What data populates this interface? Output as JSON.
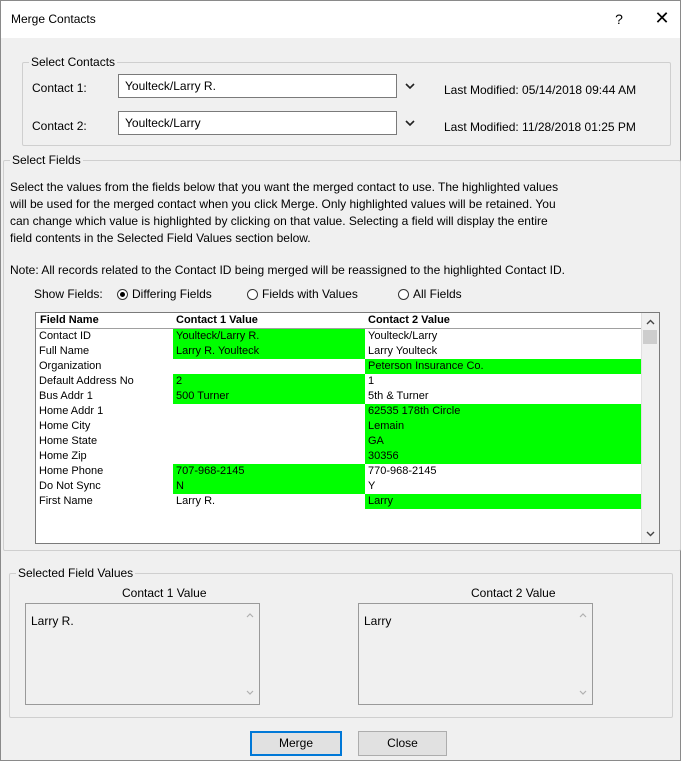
{
  "window": {
    "title": "Merge Contacts",
    "help_label": "?",
    "close_label": "✕"
  },
  "select_contacts": {
    "legend": "Select Contacts",
    "contact1_label": "Contact 1:",
    "contact1_value": "Youlteck/Larry R.",
    "contact1_modified": "Last Modified: 05/14/2018 09:44 AM",
    "contact2_label": "Contact 2:",
    "contact2_value": "Youlteck/Larry",
    "contact2_modified": "Last Modified: 11/28/2018 01:25 PM"
  },
  "select_fields": {
    "legend": "Select Fields",
    "instructions_1": "Select the values from the fields below that you want the merged contact to use.  The highlighted values",
    "instructions_2": "will be used for the merged contact when you click Merge.  Only highlighted values will be retained.  You",
    "instructions_3": "can change which value is highlighted by clicking on that value.  Selecting a field will display the entire",
    "instructions_4": "field contents in the Selected Field Values section below.",
    "note": "Note: All records related to the Contact ID being merged will be reassigned to the highlighted Contact ID.",
    "show_fields_label": "Show Fields:",
    "options": [
      "Differing Fields",
      "Fields with Values",
      "All Fields"
    ],
    "selected_option": "Differing Fields",
    "columns": [
      "Field Name",
      "Contact 1 Value",
      "Contact 2 Value"
    ],
    "rows": [
      {
        "field": "Contact ID",
        "v1": "Youlteck/Larry R.",
        "v2": "Youlteck/Larry",
        "hl": 1
      },
      {
        "field": "Full Name",
        "v1": "Larry R. Youlteck",
        "v2": "Larry Youlteck",
        "hl": 1
      },
      {
        "field": "Organization",
        "v1": "",
        "v2": "Peterson Insurance Co.",
        "hl": 2
      },
      {
        "field": "Default Address No",
        "v1": "2",
        "v2": "1",
        "hl": 1
      },
      {
        "field": "Bus Addr 1",
        "v1": "500 Turner",
        "v2": "5th & Turner",
        "hl": 1
      },
      {
        "field": "Home Addr 1",
        "v1": "",
        "v2": "62535 178th Circle",
        "hl": 2
      },
      {
        "field": "Home City",
        "v1": "",
        "v2": "Lemain",
        "hl": 2
      },
      {
        "field": "Home State",
        "v1": "",
        "v2": "GA",
        "hl": 2
      },
      {
        "field": "Home Zip",
        "v1": "",
        "v2": "30356",
        "hl": 2
      },
      {
        "field": "Home Phone",
        "v1": "707-968-2145",
        "v2": "770-968-2145",
        "hl": 1
      },
      {
        "field": "Do Not Sync",
        "v1": "N",
        "v2": "Y",
        "hl": 1
      },
      {
        "field": "First Name",
        "v1": "Larry R.",
        "v2": "Larry",
        "hl": 2
      }
    ]
  },
  "selected_values": {
    "legend": "Selected Field Values",
    "c1_label": "Contact 1 Value",
    "c1_text": "Larry R.",
    "c2_label": "Contact 2 Value",
    "c2_text": "Larry"
  },
  "buttons": {
    "merge": "Merge",
    "close": "Close"
  },
  "colors": {
    "highlight": "#00ff00"
  }
}
